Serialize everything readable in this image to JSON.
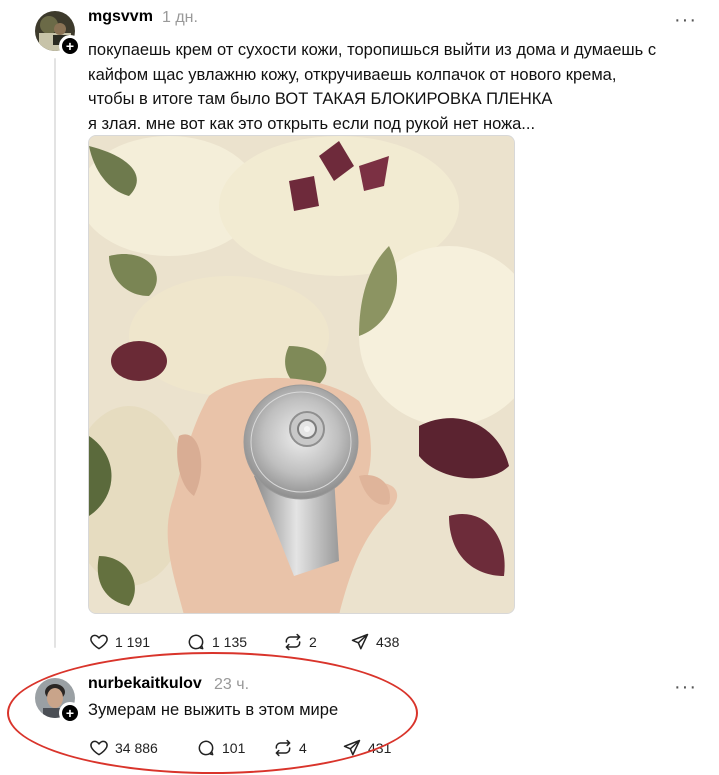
{
  "post": {
    "username": "mgsvvm",
    "time": "1 дн.",
    "more": "···",
    "text_lines": [
      "покупаешь крем от сухости кожи, торопишься выйти из дома и думаешь с",
      "кайфом щас увлажню кожу, откручиваешь колпачок от нового крема,",
      "чтобы в итоге там было ВОТ ТАКАЯ БЛОКИРОВКА ПЛЕНКА",
      "я злая. мне вот как это открыть если под рукой нет ножа..."
    ],
    "likes": "1 191",
    "comments": "1 135",
    "reposts": "2",
    "shares": "438"
  },
  "reply": {
    "username": "nurbekaitkulov",
    "time": "23 ч.",
    "more": "···",
    "text": "Зумерам не выжить в этом мире",
    "likes": "34 886",
    "comments": "101",
    "reposts": "4",
    "shares": "431"
  },
  "icons": {
    "like": "heart-icon",
    "comment": "comment-bubble-icon",
    "repost": "repost-icon",
    "share": "send-icon",
    "follow": "plus-icon"
  },
  "colors": {
    "annotation_oval": "#d9342b",
    "secondary_text": "#999999"
  }
}
